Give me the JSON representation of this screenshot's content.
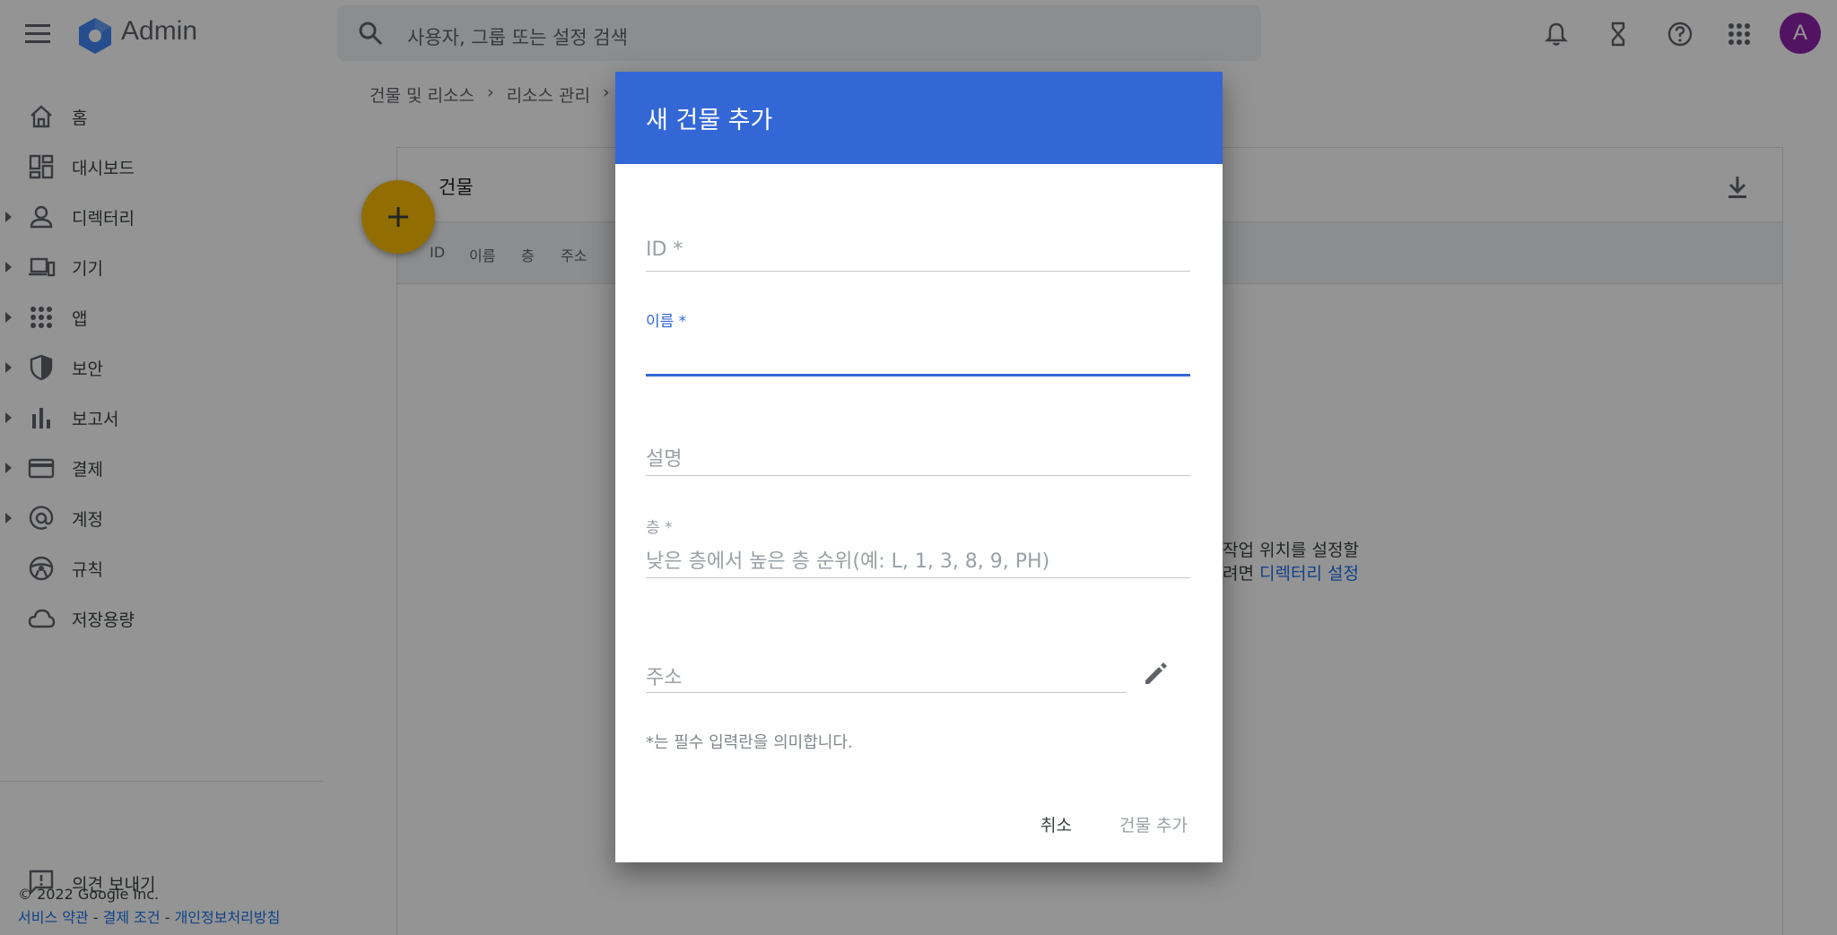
{
  "app": {
    "title": "Admin",
    "avatar_letter": "A"
  },
  "search": {
    "placeholder": "사용자, 그룹 또는 설정 검색"
  },
  "sidebar": {
    "items": [
      {
        "label": "홈",
        "expandable": false
      },
      {
        "label": "대시보드",
        "expandable": false
      },
      {
        "label": "디렉터리",
        "expandable": true
      },
      {
        "label": "기기",
        "expandable": true
      },
      {
        "label": "앱",
        "expandable": true
      },
      {
        "label": "보안",
        "expandable": true
      },
      {
        "label": "보고서",
        "expandable": true
      },
      {
        "label": "결제",
        "expandable": true
      },
      {
        "label": "계정",
        "expandable": true
      },
      {
        "label": "규칙",
        "expandable": false
      },
      {
        "label": "저장용량",
        "expandable": false
      }
    ],
    "feedback": "의견 보내기",
    "copyright": "© 2022 Google Inc.",
    "links": [
      "서비스 약관",
      "결제 조건",
      "개인정보처리방침"
    ],
    "link_separator": " - "
  },
  "breadcrumb": {
    "items": [
      "건물 및 리소스",
      "리소스 관리"
    ],
    "separator": "›"
  },
  "card": {
    "title": "건물",
    "columns": [
      "ID",
      "이름",
      "층",
      "주소"
    ],
    "empty_line1": "작업 위치를 설정할",
    "empty_line2_prefix": "려면",
    "empty_link": "디렉터리 설정"
  },
  "dialog": {
    "title": "새 건물 추가",
    "fields": {
      "id": {
        "label": "ID *",
        "value": ""
      },
      "name": {
        "label": "이름 *",
        "value": ""
      },
      "description": {
        "label": "설명",
        "value": ""
      },
      "floors": {
        "label": "층 *",
        "placeholder": "낮은 층에서 높은 층 순위(예: L, 1, 3, 8, 9, PH)"
      },
      "address": {
        "label": "주소"
      }
    },
    "helper": "*는 필수 입력란을 의미합니다.",
    "cancel_label": "취소",
    "submit_label": "건물 추가"
  },
  "colors": {
    "accent": "#3367d6",
    "fab": "#fbbc04",
    "avatar": "#8e24aa",
    "link": "#1a73e8"
  }
}
